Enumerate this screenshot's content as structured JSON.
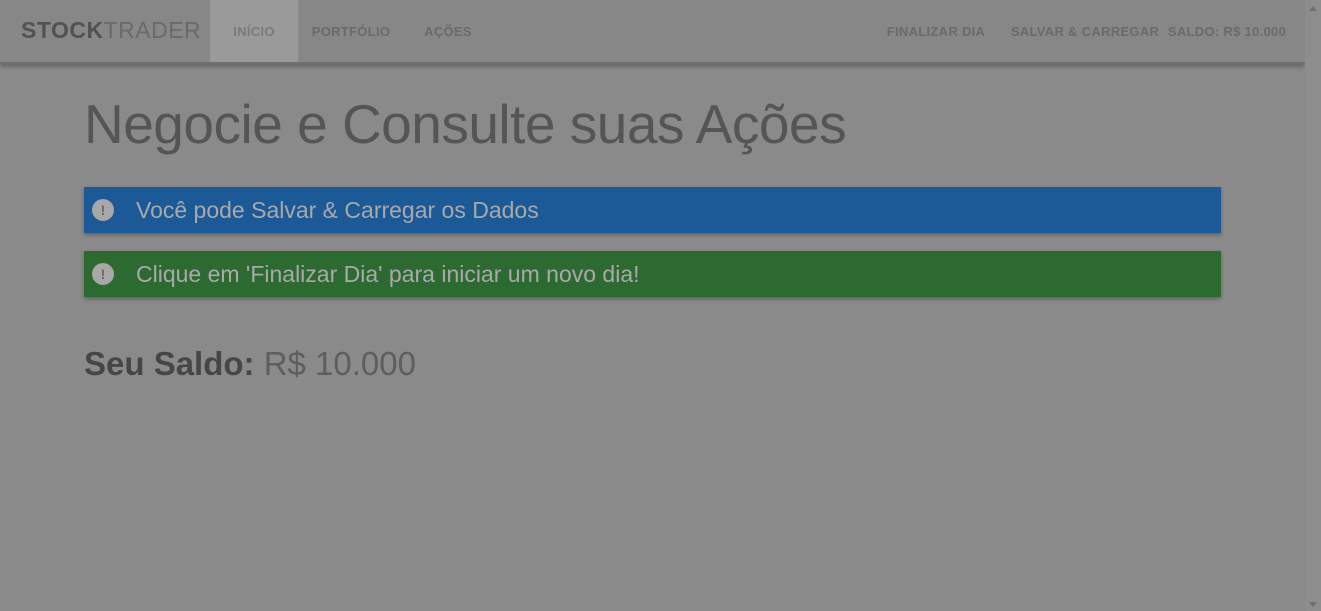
{
  "navbar": {
    "brand_strong": "STOCK",
    "brand_light": "TRADER",
    "items": [
      {
        "label": "INÍCIO"
      },
      {
        "label": "PORTFÓLIO"
      },
      {
        "label": "AÇÕES"
      }
    ],
    "end_day_label": "FINALIZAR DIA",
    "save_load_label": "SALVAR & CARREGAR",
    "balance_label": "SALDO: R$ 10.000"
  },
  "main": {
    "title": "Negocie e Consulte suas Ações",
    "alerts": [
      {
        "text": "Você pode Salvar & Carregar os Dados",
        "color": "#1b5a97"
      },
      {
        "text": "Clique em 'Finalizar Dia' para iniciar um novo dia!",
        "color": "#2d6a32"
      }
    ],
    "balance_label": "Seu Saldo:",
    "balance_value": "R$ 10.000"
  },
  "icons": {
    "alert_icon": "info-icon"
  }
}
